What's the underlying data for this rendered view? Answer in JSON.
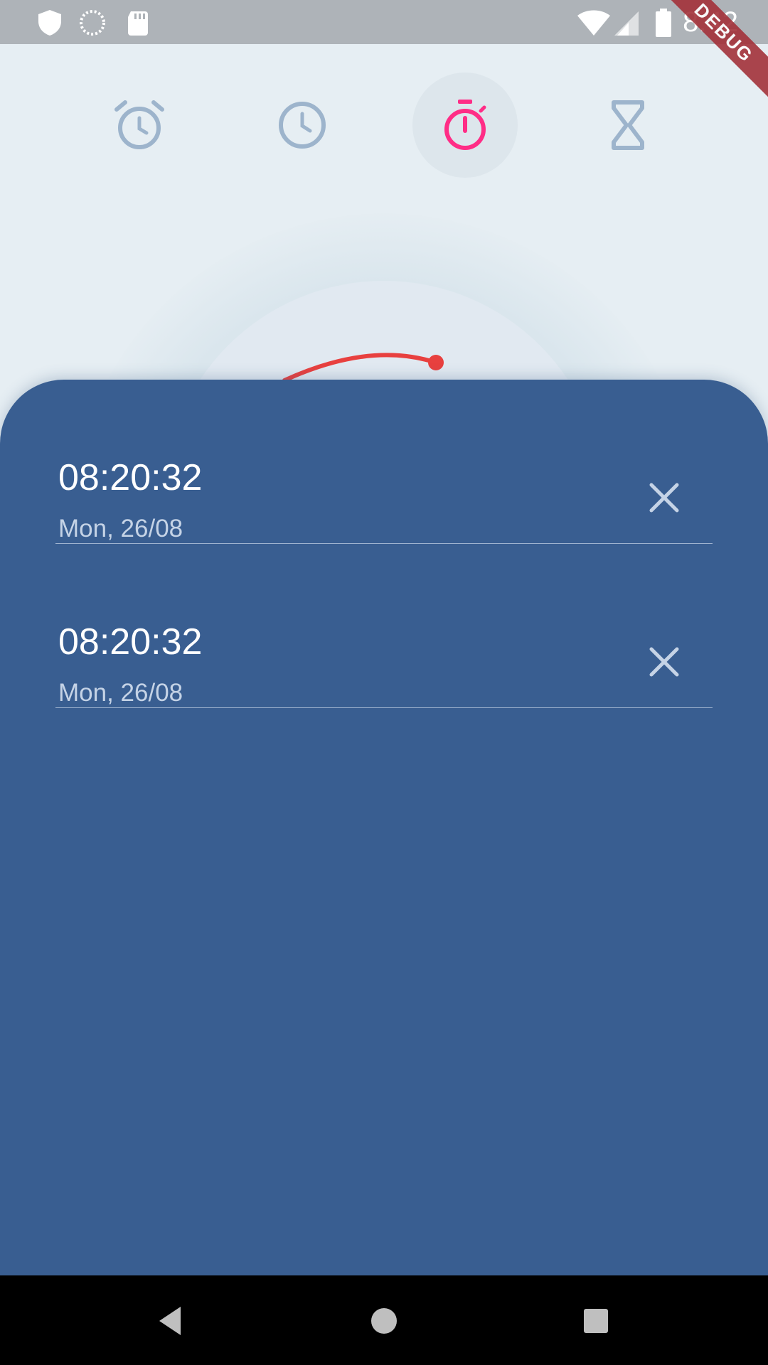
{
  "status_bar": {
    "time": "8:42",
    "debug_banner": "DEBUG",
    "left_icons": [
      "shield-icon",
      "sync-icon",
      "sd-card-icon"
    ],
    "right_icons": [
      "wifi-icon",
      "signal-icon",
      "battery-icon"
    ]
  },
  "nav": {
    "tabs": [
      {
        "name": "alarm",
        "icon": "alarm-clock-icon",
        "active": false
      },
      {
        "name": "clock",
        "icon": "clock-icon",
        "active": false
      },
      {
        "name": "stopwatch",
        "icon": "stopwatch-icon",
        "active": true
      },
      {
        "name": "timer",
        "icon": "hourglass-icon",
        "active": false
      }
    ],
    "active_color": "#ff2d86",
    "inactive_color": "#9db4cc"
  },
  "dial": {
    "arc_color": "#e8403f"
  },
  "laps": [
    {
      "time": "08:20:32",
      "date": "Mon, 26/08"
    },
    {
      "time": "08:20:32",
      "date": "Mon, 26/08"
    }
  ],
  "colors": {
    "sheet": "#395e91",
    "background": "#e6eef3"
  },
  "system_nav": {
    "buttons": [
      "back-icon",
      "home-icon",
      "recents-icon"
    ]
  }
}
